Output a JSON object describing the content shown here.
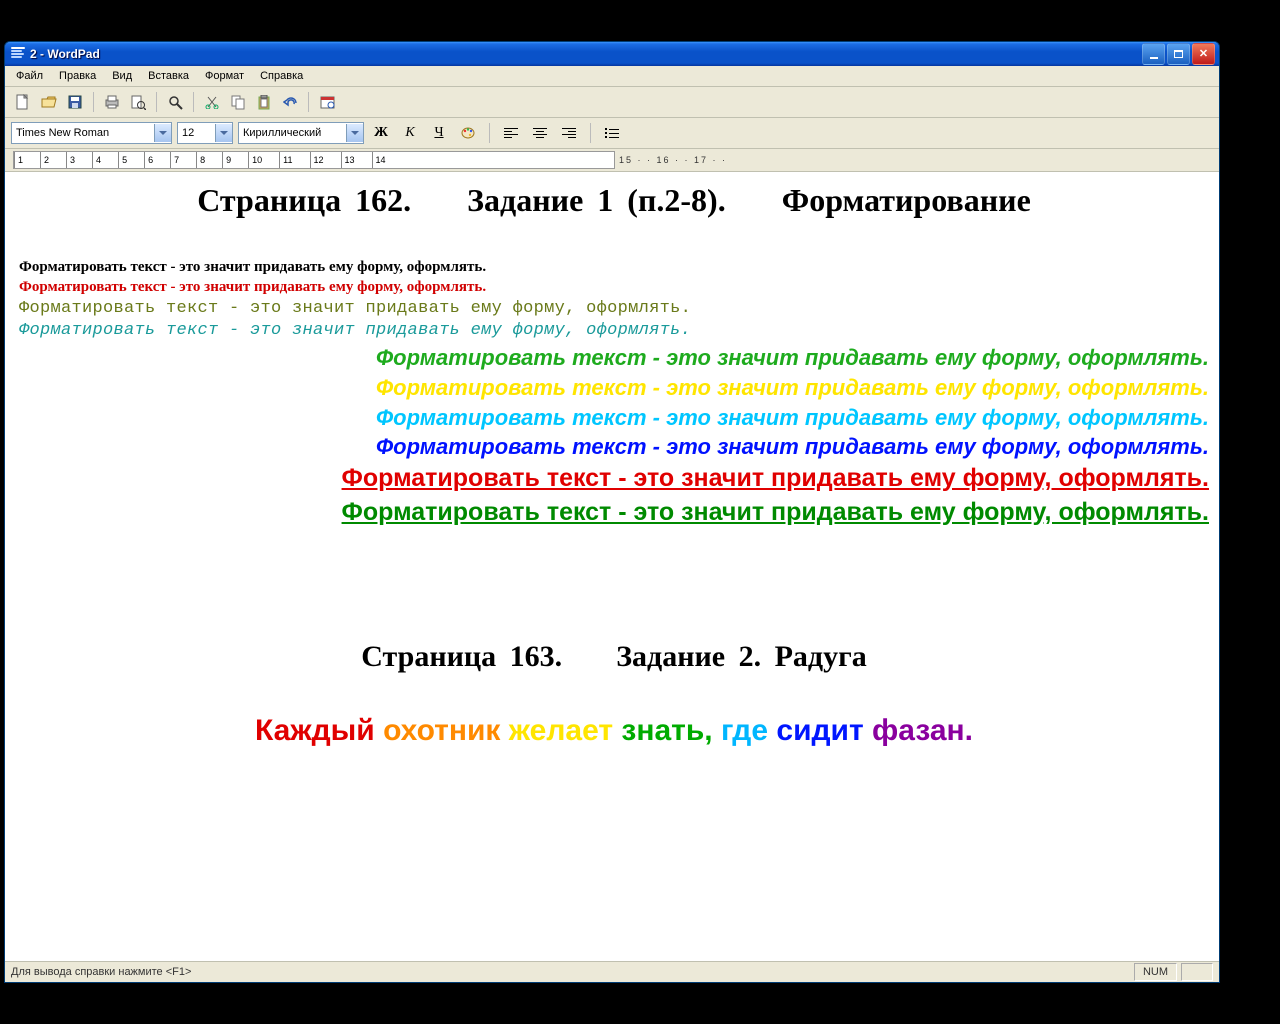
{
  "window": {
    "title": "2 - WordPad"
  },
  "menu": {
    "file": "Файл",
    "edit": "Правка",
    "view": "Вид",
    "insert": "Вставка",
    "format": "Формат",
    "help": "Справка"
  },
  "format": {
    "font": "Times New Roman",
    "size": "12",
    "script": "Кириллический",
    "bold": "Ж",
    "italic": "К",
    "underline": "Ч"
  },
  "ruler": {
    "marks": [
      "1",
      "2",
      "3",
      "4",
      "5",
      "6",
      "7",
      "8",
      "9",
      "10",
      "11",
      "12",
      "13",
      "14"
    ],
    "tail": "15 · · 16 · · 17 · ·"
  },
  "doc": {
    "heading1_parts": [
      "Страница 162.",
      "Задание 1 (п.2-8).",
      "Форматирование"
    ],
    "sentence": "Форматировать текст - это значит придавать ему форму, оформлять.",
    "heading2_parts": [
      "Страница 163.",
      "Задание 2. Радуга"
    ],
    "rainbow": {
      "w1": "Каждый",
      "w2": "охотник",
      "w3": "желает",
      "w4": "знать,",
      "w5": "где",
      "w6": "сидит",
      "w7": "фазан."
    }
  },
  "status": {
    "hint": "Для вывода справки нажмите <F1>",
    "num": "NUM"
  }
}
